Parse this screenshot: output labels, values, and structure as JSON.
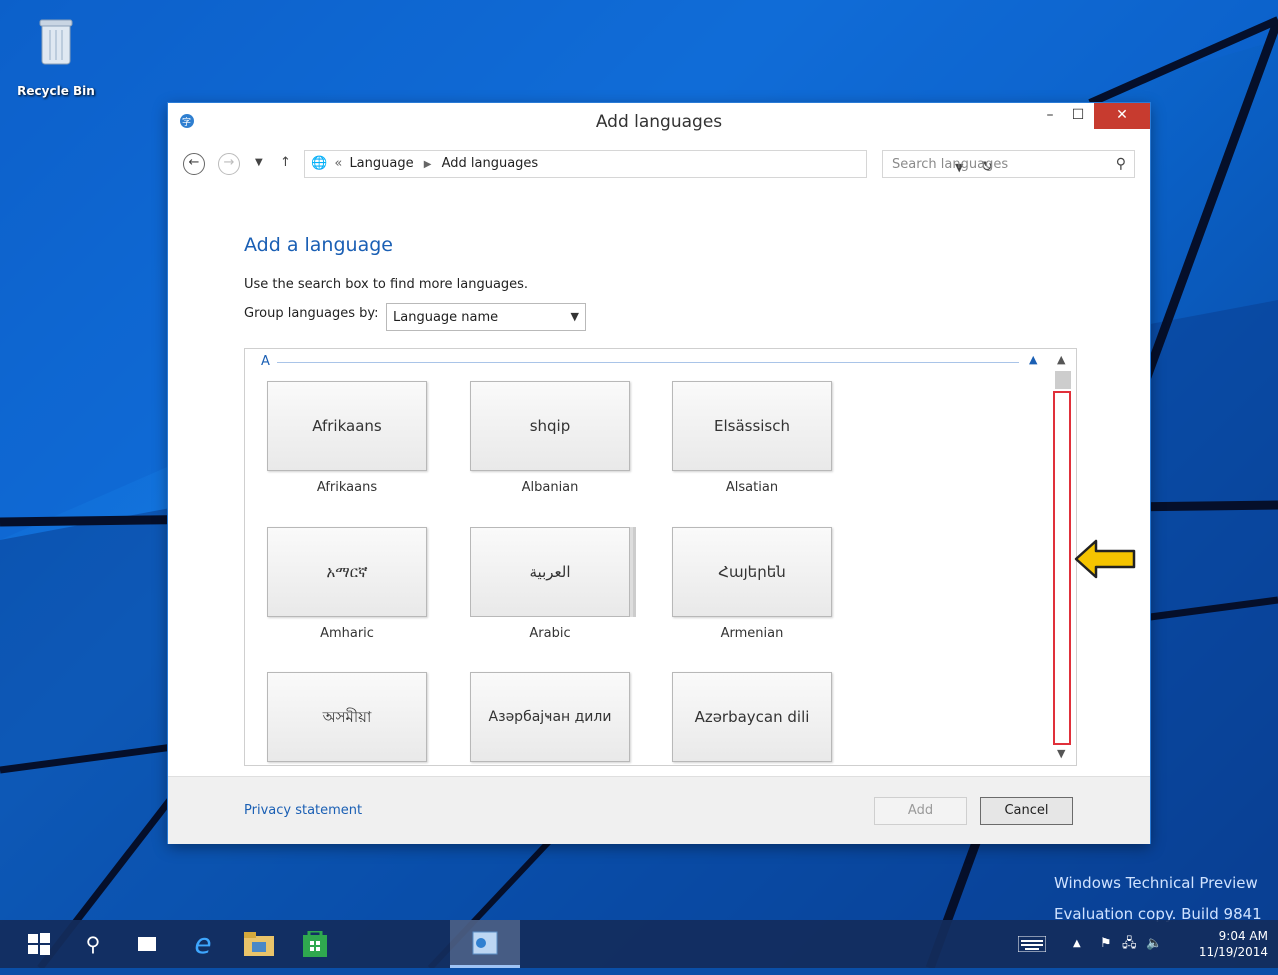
{
  "desktop": {
    "recycle_bin_label": "Recycle Bin",
    "watermark_line1": "Windows Technical Preview",
    "watermark_line2": "Evaluation copy. Build 9841"
  },
  "window": {
    "title": "Add languages",
    "controls": {
      "minimize": "–",
      "maximize": "☐",
      "close": "✕"
    }
  },
  "nav": {
    "breadcrumb_prefix": "«",
    "breadcrumbs": [
      "Language",
      "Add languages"
    ],
    "search_placeholder": "Search languages"
  },
  "content": {
    "heading": "Add a language",
    "hint": "Use the search box to find more languages.",
    "group_label": "Group languages by:",
    "group_value": "Language name",
    "group_letter": "A"
  },
  "languages": [
    {
      "native": "Afrikaans",
      "english": "Afrikaans"
    },
    {
      "native": "shqip",
      "english": "Albanian"
    },
    {
      "native": "Elsässisch",
      "english": "Alsatian"
    },
    {
      "native": "አማርኛ",
      "english": "Amharic"
    },
    {
      "native": "العربية",
      "english": "Arabic"
    },
    {
      "native": "Հայերեն",
      "english": "Armenian"
    },
    {
      "native": "অসমীয়া",
      "english": ""
    },
    {
      "native": "Азәрбајҹан дили",
      "english": ""
    },
    {
      "native": "Azərbaycan dili",
      "english": ""
    }
  ],
  "footer": {
    "privacy": "Privacy statement",
    "add": "Add",
    "cancel": "Cancel"
  },
  "taskbar": {
    "time": "9:04 AM",
    "date": "11/19/2014"
  },
  "colors": {
    "accent": "#1a5fb4",
    "close_button": "#c73b2f",
    "scroll_highlight": "#e0303a",
    "annotation_arrow": "#f5c400"
  }
}
